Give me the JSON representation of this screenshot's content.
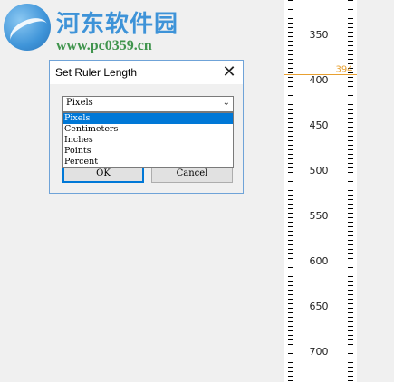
{
  "watermark": {
    "site_name": "河东软件园",
    "site_url": "www.pc0359.cn"
  },
  "dialog": {
    "title": "Set Ruler Length",
    "close_label": "✕",
    "unit_select": {
      "selected": "Pixels",
      "options": [
        "Pixels",
        "Centimeters",
        "Inches",
        "Points",
        "Percent"
      ]
    },
    "ok_label": "OK",
    "cancel_label": "Cancel"
  },
  "ruler": {
    "labels": [
      "350",
      "400",
      "450",
      "500",
      "550",
      "600",
      "650",
      "700"
    ],
    "cursor_value": "394",
    "cursor_color": "#e8a030"
  },
  "colors": {
    "accent": "#0078d7",
    "window_border": "#6fa3d8"
  }
}
